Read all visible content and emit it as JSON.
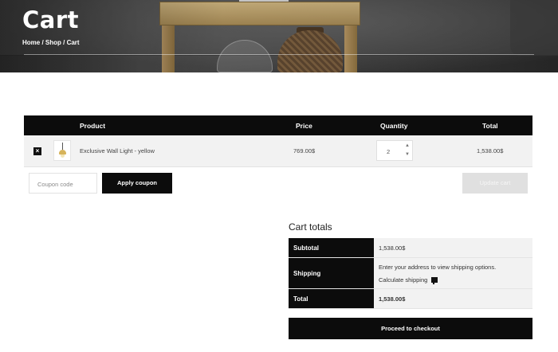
{
  "hero": {
    "title": "Cart",
    "breadcrumb": [
      "Home",
      "Shop",
      "Cart"
    ],
    "separator": " / "
  },
  "cart_table": {
    "headers": {
      "product": "Product",
      "price": "Price",
      "quantity": "Quantity",
      "total": "Total"
    },
    "items": [
      {
        "remove_icon": "×",
        "product": "Exclusive Wall Light - yellow",
        "price": "769.00$",
        "quantity": "2",
        "total": "1,538.00$"
      }
    ]
  },
  "actions": {
    "coupon_placeholder": "Coupon code",
    "apply_coupon": "Apply coupon",
    "update_cart": "Update cart"
  },
  "cart_totals": {
    "title": "Cart totals",
    "subtotal_label": "Subtotal",
    "subtotal_value": "1,538.00$",
    "shipping_label": "Shipping",
    "shipping_note": "Enter your address to view shipping options.",
    "calculate_shipping": "Calculate shipping",
    "total_label": "Total",
    "total_value": "1,538.00$",
    "checkout": "Proceed to checkout"
  },
  "icons": {
    "remove": "remove-icon",
    "stepper_up": "chevron-up-icon",
    "stepper_down": "chevron-down-icon",
    "shipping": "truck-icon"
  },
  "colors": {
    "header_black": "#0c0c0c",
    "row_gray": "#f2f2f2",
    "disabled_button": "#e0e0e0"
  }
}
